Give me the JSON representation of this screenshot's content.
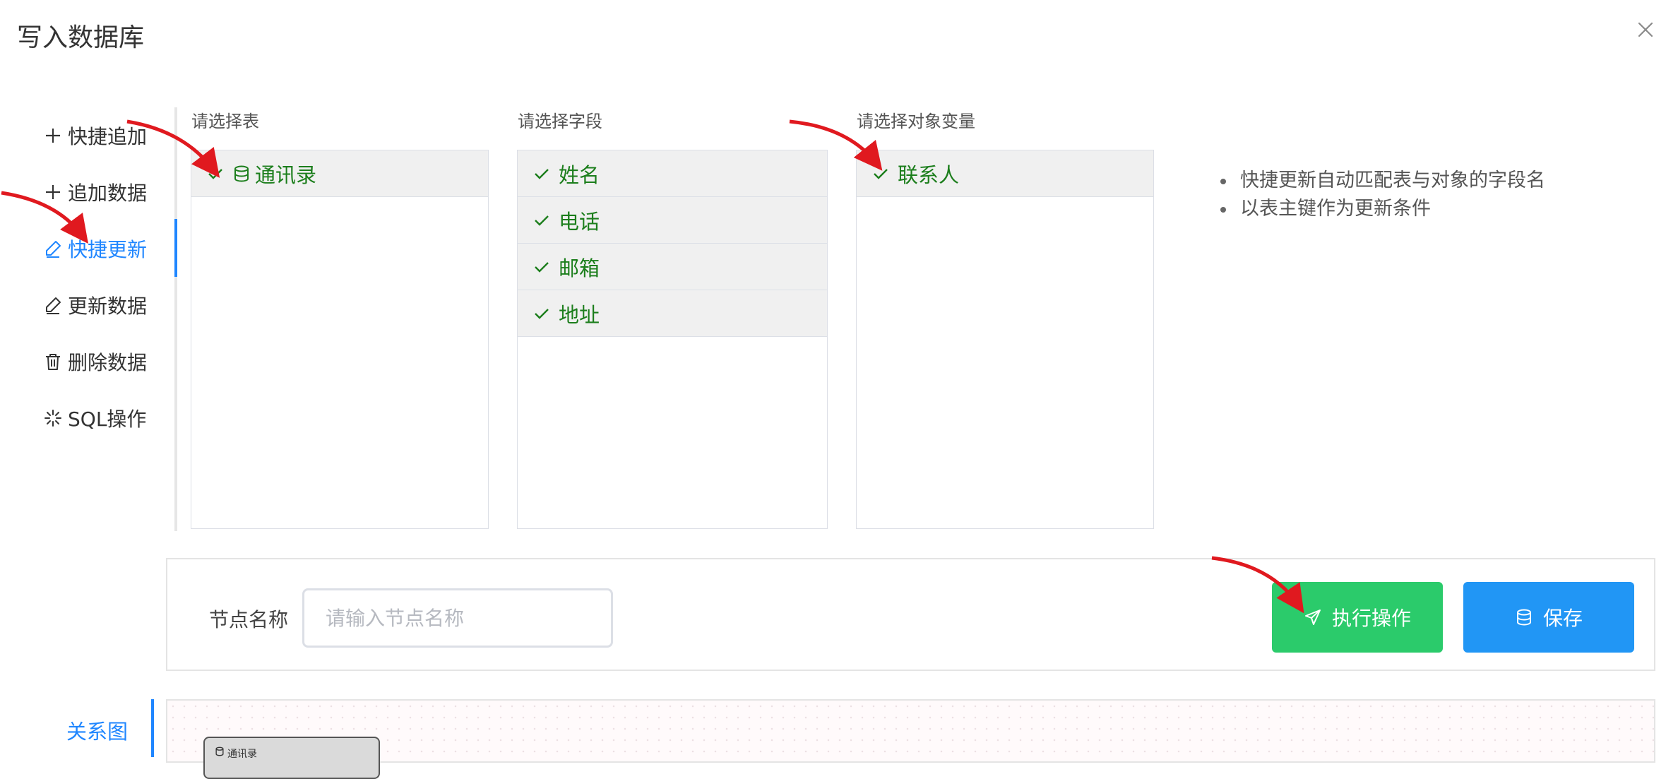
{
  "dialog": {
    "title": "写入数据库"
  },
  "menu": [
    {
      "label": "快捷追加",
      "icon": "plus-icon",
      "active": false
    },
    {
      "label": "追加数据",
      "icon": "plus-icon",
      "active": false
    },
    {
      "label": "快捷更新",
      "icon": "edit-icon",
      "active": true
    },
    {
      "label": "更新数据",
      "icon": "edit-icon",
      "active": false
    },
    {
      "label": "删除数据",
      "icon": "trash-icon",
      "active": false
    },
    {
      "label": "SQL操作",
      "icon": "sparkle-icon",
      "active": false
    }
  ],
  "tables": {
    "label": "请选择表",
    "items": [
      {
        "text": "通讯录",
        "selected": true,
        "icon": "database-icon"
      }
    ]
  },
  "fields": {
    "label": "请选择字段",
    "items": [
      {
        "text": "姓名",
        "selected": true
      },
      {
        "text": "电话",
        "selected": true
      },
      {
        "text": "邮箱",
        "selected": true
      },
      {
        "text": "地址",
        "selected": true
      }
    ]
  },
  "objects": {
    "label": "请选择对象变量",
    "items": [
      {
        "text": "联系人",
        "selected": true
      }
    ]
  },
  "hints": [
    "快捷更新自动匹配表与对象的字段名",
    "以表主键作为更新条件"
  ],
  "form": {
    "node_name_label": "节点名称",
    "node_name_placeholder": "请输入节点名称",
    "node_name_value": ""
  },
  "buttons": {
    "execute": "执行操作",
    "save": "保存"
  },
  "bottom": {
    "tab": "关系图",
    "graph_node": "通讯录"
  },
  "colors": {
    "accent": "#1f86ff",
    "selected_text": "#1c7e1c",
    "execute": "#2bcb6b",
    "save": "#2196f5",
    "annotation_arrow": "#e0191f"
  }
}
